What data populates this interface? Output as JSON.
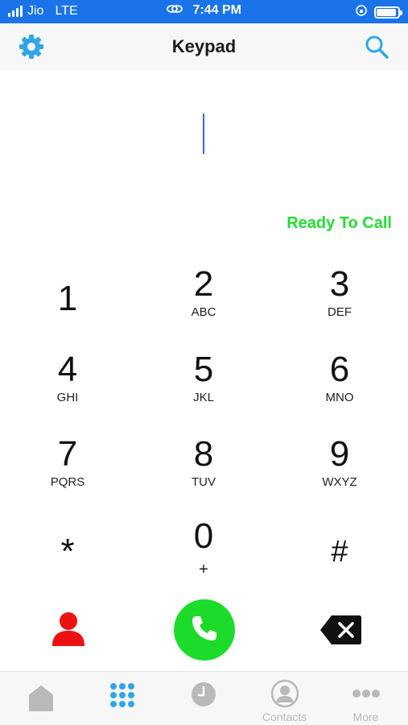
{
  "status_bar": {
    "carrier": "Jio",
    "network": "LTE",
    "time": "7:44 PM"
  },
  "nav": {
    "title": "Keypad",
    "left_icon": "gear-icon",
    "right_icon": "search-icon"
  },
  "number_display": {
    "value": ""
  },
  "call_status": "Ready To Call",
  "keypad": {
    "keys": [
      {
        "digit": "1",
        "letters": ""
      },
      {
        "digit": "2",
        "letters": "ABC"
      },
      {
        "digit": "3",
        "letters": "DEF"
      },
      {
        "digit": "4",
        "letters": "GHI"
      },
      {
        "digit": "5",
        "letters": "JKL"
      },
      {
        "digit": "6",
        "letters": "MNO"
      },
      {
        "digit": "7",
        "letters": "PQRS"
      },
      {
        "digit": "8",
        "letters": "TUV"
      },
      {
        "digit": "9",
        "letters": "WXYZ"
      },
      {
        "digit": "*",
        "letters": ""
      },
      {
        "digit": "0",
        "letters": "+"
      },
      {
        "digit": "#",
        "letters": ""
      }
    ]
  },
  "actions": {
    "contact_icon": "person-icon",
    "call_icon": "phone-icon",
    "delete_icon": "backspace-icon"
  },
  "tabs": [
    {
      "label": "",
      "icon": "home-icon"
    },
    {
      "label": "",
      "icon": "keypad-icon",
      "active": true
    },
    {
      "label": "",
      "icon": "clock-icon"
    },
    {
      "label": "Contacts",
      "icon": "contact-circle-icon"
    },
    {
      "label": "More",
      "icon": "more-icon"
    }
  ],
  "colors": {
    "status_bar": "#1a73e8",
    "accent": "#2fa6e8",
    "call_green": "#1ddb2a",
    "ready_green": "#22dd33",
    "contact_red": "#ee1111",
    "tab_inactive": "#b9b9b9"
  }
}
